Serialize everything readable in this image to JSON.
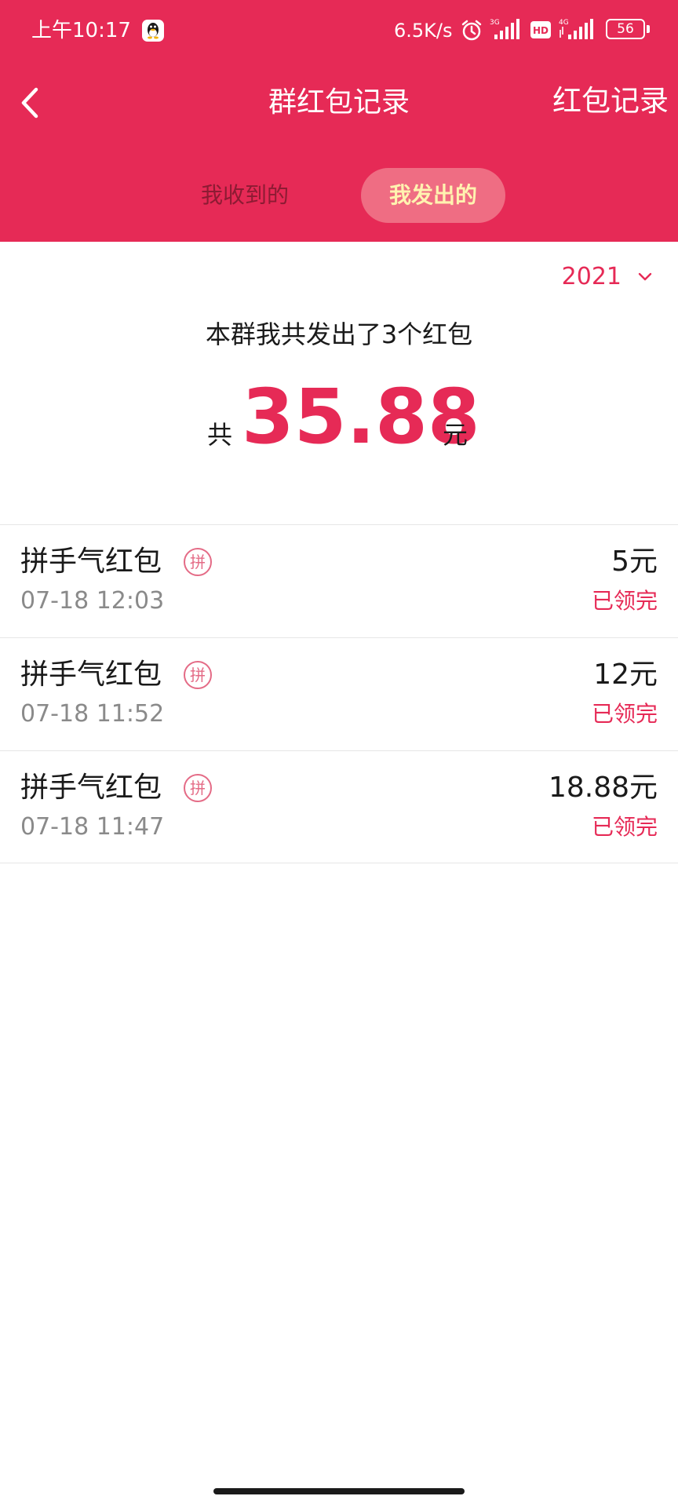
{
  "status_bar": {
    "time": "上午10:17",
    "speed": "6.5K/s",
    "battery": "56",
    "icons": [
      "qq-icon",
      "alarm-icon",
      "signal-3g-icon",
      "hd-icon",
      "signal-4g-icon",
      "battery-icon"
    ]
  },
  "nav": {
    "title": "群红包记录",
    "right_link": "红包记录",
    "back_icon": "back-arrow-icon"
  },
  "tabs": [
    {
      "label": "我收到的",
      "active": false
    },
    {
      "label": "我发出的",
      "active": true
    }
  ],
  "summary": {
    "year": "2021",
    "text": "本群我共发出了3个红包",
    "total_prefix": "共",
    "total_amount": "35.88",
    "total_unit": "元"
  },
  "records": [
    {
      "title": "拼手气红包",
      "badge": "拼",
      "time": "07-18 12:03",
      "amount": "5元",
      "status": "已领完"
    },
    {
      "title": "拼手气红包",
      "badge": "拼",
      "time": "07-18 11:52",
      "amount": "12元",
      "status": "已领完"
    },
    {
      "title": "拼手气红包",
      "badge": "拼",
      "time": "07-18 11:47",
      "amount": "18.88元",
      "status": "已领完"
    }
  ],
  "colors": {
    "brand": "#e62a56",
    "tab_active_bg": "#ef6d83",
    "tab_active_text": "#fff3b0",
    "secondary_text": "#8a8a8a"
  }
}
